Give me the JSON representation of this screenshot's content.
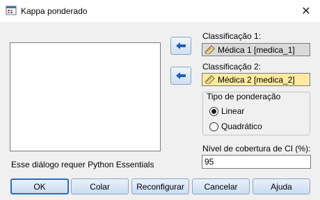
{
  "window": {
    "title": "Kappa ponderado",
    "close_glyph": "✕"
  },
  "left_panel": {
    "note": "Esse diálogo requer Python Essentials"
  },
  "rating1": {
    "label": "Classificação 1:",
    "value": "Médica 1 [medica_1]",
    "icon": "ruler-icon"
  },
  "rating2": {
    "label": "Classificação 2:",
    "value": "Médica 2 [medica_2]",
    "icon": "ruler-icon"
  },
  "weighting": {
    "legend": "Tipo de ponderação",
    "options": [
      {
        "label": "Linear",
        "selected": true
      },
      {
        "label": "Quadrático",
        "selected": false
      }
    ]
  },
  "ci": {
    "label": "Nível de cobertura de CI (%):",
    "value": "95"
  },
  "buttons": {
    "ok": "OK",
    "paste": "Colar",
    "reset": "Reconfigurar",
    "cancel": "Cancelar",
    "help": "Ajuda"
  },
  "colors": {
    "arrow": "#1f5fb4",
    "selected_field": "#ffeaa0",
    "disabled_field": "#d9d9d9"
  }
}
